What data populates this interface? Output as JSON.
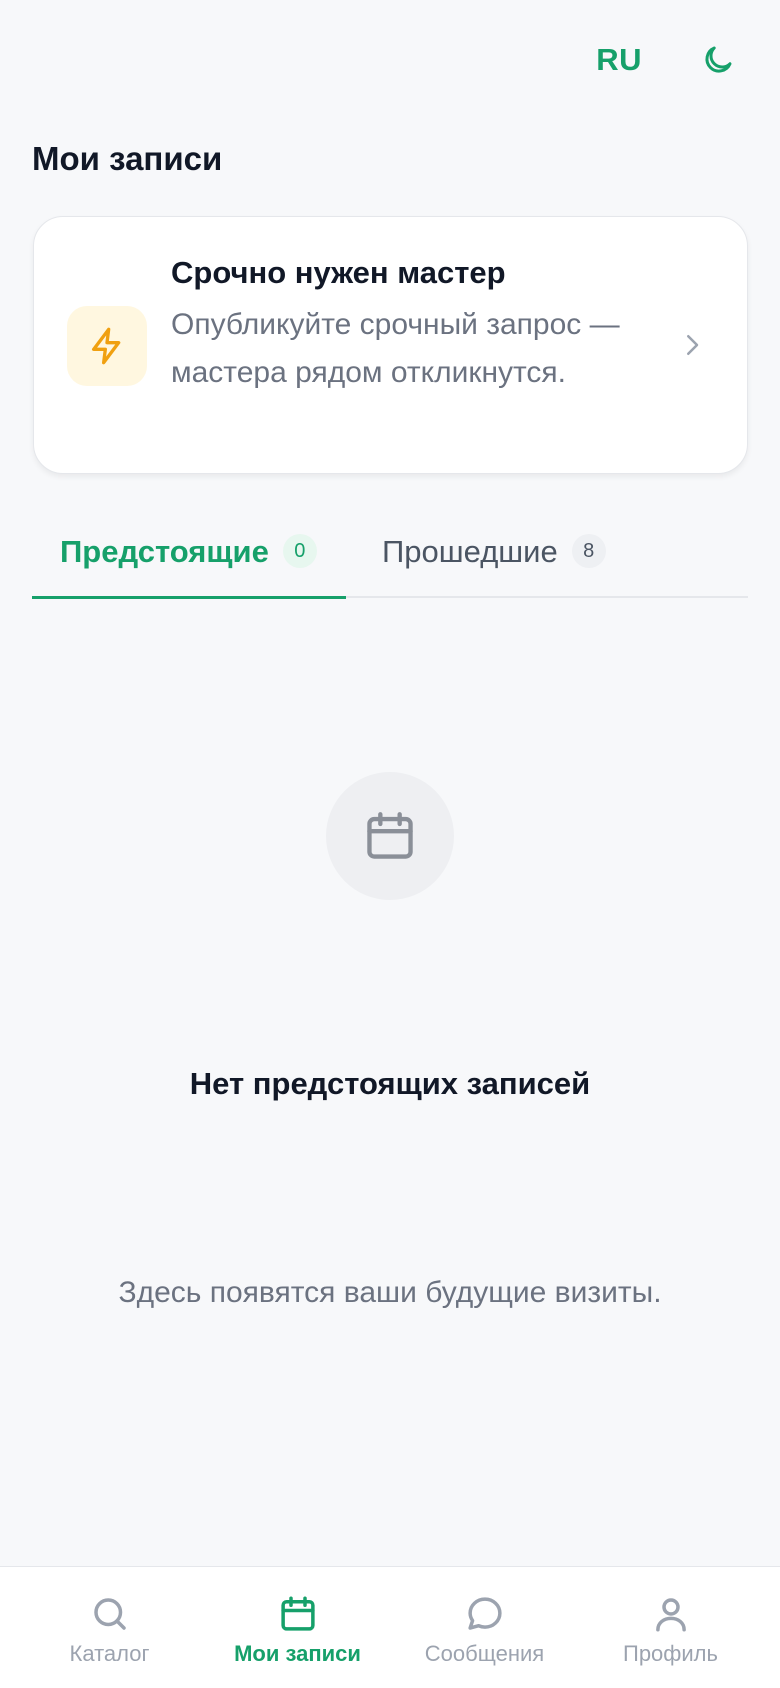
{
  "header": {
    "language": "RU",
    "theme_icon": "moon-icon",
    "title": "Мои записи"
  },
  "urgent_card": {
    "icon": "lightning-icon",
    "title": "Срочно нужен мастер",
    "description": "Опубликуйте срочный запрос — мастера рядом откликнутся.",
    "chevron_icon": "chevron-right-icon"
  },
  "tabs": [
    {
      "label": "Предстоящие",
      "count": "0",
      "active": true
    },
    {
      "label": "Прошедшие",
      "count": "8",
      "active": false
    }
  ],
  "empty_state": {
    "icon": "calendar-icon",
    "title": "Нет предстоящих записей",
    "description": "Здесь появятся ваши будущие визиты."
  },
  "bottom_nav": {
    "items": [
      {
        "label": "Каталог",
        "icon": "search-icon",
        "active": false
      },
      {
        "label": "Мои записи",
        "icon": "calendar-icon",
        "active": true
      },
      {
        "label": "Сообщения",
        "icon": "chat-bubble-icon",
        "active": false
      },
      {
        "label": "Профиль",
        "icon": "user-icon",
        "active": false
      }
    ]
  },
  "colors": {
    "accent": "#16a06a",
    "background": "#f7f8fa",
    "urgent_icon_bg": "#fff7e0",
    "urgent_icon": "#f0a010"
  }
}
